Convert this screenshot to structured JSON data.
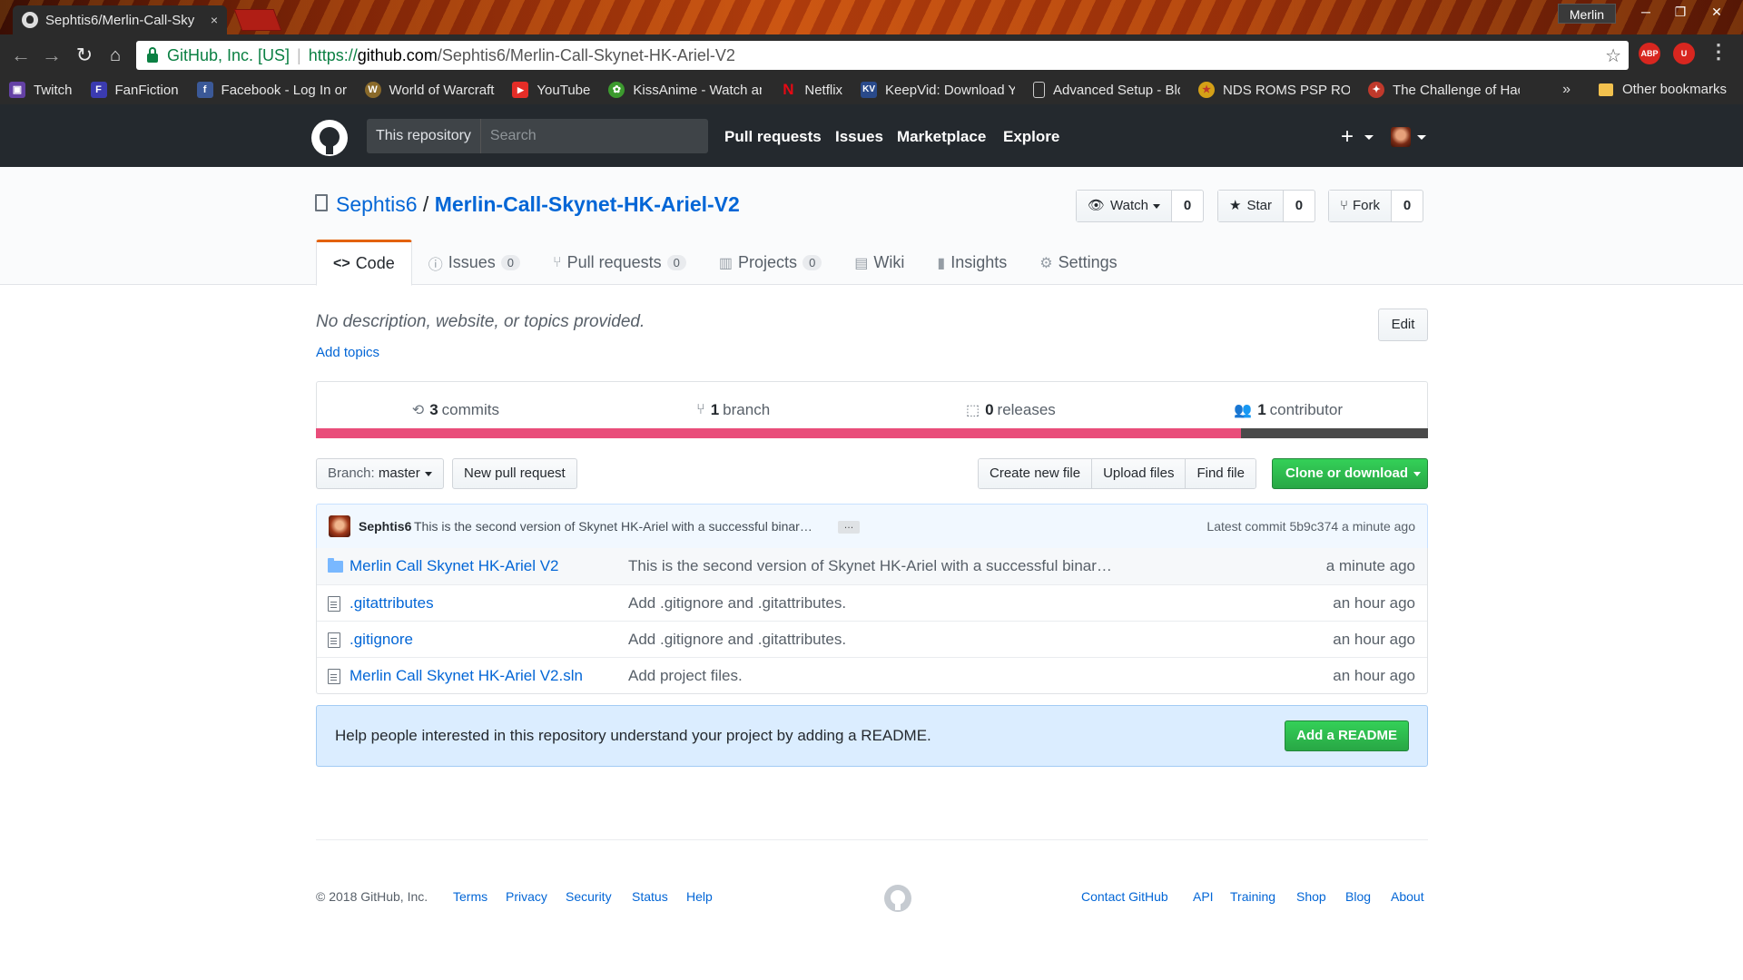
{
  "browser": {
    "tab_title": "Sephtis6/Merlin-Call-Sky",
    "tab_close": "×",
    "user": "Merlin",
    "window_controls": [
      "─",
      "❐",
      "✕"
    ],
    "omnibox": {
      "secure_label": "GitHub, Inc. [US]",
      "url_scheme": "https://",
      "url_host": "github.com",
      "url_path": "/Sephtis6/Merlin-Call-Skynet-HK-Ariel-V2"
    },
    "extensions": [
      "ABP",
      "U"
    ],
    "bookmarks": [
      {
        "label": "Twitch",
        "icon": "twitch-icon",
        "color": "#6441a5",
        "glyph": "▣"
      },
      {
        "label": "FanFiction",
        "icon": "fanfiction-icon",
        "color": "#3b3bb0",
        "glyph": "F"
      },
      {
        "label": "Facebook - Log In or",
        "icon": "facebook-icon",
        "color": "#3b5998",
        "glyph": "f"
      },
      {
        "label": "World of Warcraft",
        "icon": "warcraft-icon",
        "color": "#8a6a2a",
        "glyph": "W"
      },
      {
        "label": "YouTube",
        "icon": "youtube-icon",
        "color": "#e52d27",
        "glyph": "▶"
      },
      {
        "label": "KissAnime - Watch ar",
        "icon": "kissanime-icon",
        "color": "#3c9a2e",
        "glyph": "✿"
      },
      {
        "label": "Netflix",
        "icon": "netflix-icon",
        "color": "#b20710",
        "glyph": "N"
      },
      {
        "label": "KeepVid: Download Y",
        "icon": "keepvid-icon",
        "color": "#2a4a8a",
        "glyph": "KV"
      },
      {
        "label": "Advanced Setup - Blc",
        "icon": "page-icon",
        "color": "#cccccc",
        "glyph": ""
      },
      {
        "label": "NDS ROMS PSP ROM",
        "icon": "nds-icon",
        "color": "#d4a017",
        "glyph": "★"
      },
      {
        "label": "The Challenge of Hac",
        "icon": "challenge-icon",
        "color": "#c0392b",
        "glyph": "✦"
      }
    ],
    "bookmarks_more": "»",
    "other_bookmarks": "Other bookmarks"
  },
  "header": {
    "scope_label": "This repository",
    "search_placeholder": "Search",
    "nav": [
      "Pull requests",
      "Issues",
      "Marketplace",
      "Explore"
    ],
    "plus": "+"
  },
  "repo": {
    "owner": "Sephtis6",
    "separator": "/",
    "name": "Merlin-Call-Skynet-HK-Ariel-V2",
    "watch": {
      "label": "Watch",
      "count": "0"
    },
    "star": {
      "label": "Star",
      "count": "0"
    },
    "fork": {
      "label": "Fork",
      "count": "0"
    },
    "tabs": [
      {
        "label": "Code",
        "icon": "<>",
        "counter": ""
      },
      {
        "label": "Issues",
        "icon": "ⓘ",
        "counter": "0"
      },
      {
        "label": "Pull requests",
        "icon": "⑂",
        "counter": "0"
      },
      {
        "label": "Projects",
        "icon": "▥",
        "counter": "0"
      },
      {
        "label": "Wiki",
        "icon": "▤",
        "counter": ""
      },
      {
        "label": "Insights",
        "icon": "▮",
        "counter": ""
      },
      {
        "label": "Settings",
        "icon": "⚙",
        "counter": ""
      }
    ]
  },
  "main": {
    "description": "No description, website, or topics provided.",
    "add_topics": "Add topics",
    "edit": "Edit",
    "summary": [
      {
        "count": "3",
        "label": "commits",
        "icon": "⟲"
      },
      {
        "count": "1",
        "label": "branch",
        "icon": "⑂"
      },
      {
        "count": "0",
        "label": "releases",
        "icon": "⬚"
      },
      {
        "count": "1",
        "label": "contributor",
        "icon": "👥"
      }
    ],
    "languages": [
      {
        "share": 0.832,
        "color": "#e94d7a"
      },
      {
        "share": 0.168,
        "color": "#4a4a4a"
      }
    ],
    "branch_prefix": "Branch:",
    "branch_name": "master",
    "new_pull_request": "New pull request",
    "file_actions": [
      "Create new file",
      "Upload files",
      "Find file"
    ],
    "clone": "Clone or download",
    "commit": {
      "author": "Sephtis6",
      "message": "This is the second version of Skynet HK-Ariel with a successful binar…",
      "dots": "…",
      "latest_label": "Latest commit",
      "sha": "5b9c374",
      "age": "a minute ago"
    },
    "files": [
      {
        "type": "dir",
        "name": "Merlin Call Skynet HK-Ariel V2",
        "message": "This is the second version of Skynet HK-Ariel with a successful binar…",
        "age": "a minute ago"
      },
      {
        "type": "file",
        "name": ".gitattributes",
        "message": "Add .gitignore and .gitattributes.",
        "age": "an hour ago"
      },
      {
        "type": "file",
        "name": ".gitignore",
        "message": "Add .gitignore and .gitattributes.",
        "age": "an hour ago"
      },
      {
        "type": "file",
        "name": "Merlin Call Skynet HK-Ariel V2.sln",
        "message": "Add project files.",
        "age": "an hour ago"
      }
    ],
    "readme_prompt": "Help people interested in this repository understand your project by adding a README.",
    "readme_button": "Add a README"
  },
  "footer": {
    "copyright": "© 2018 GitHub, Inc.",
    "left_links": [
      "Terms",
      "Privacy",
      "Security",
      "Status",
      "Help"
    ],
    "right_links": [
      "Contact GitHub",
      "API",
      "Training",
      "Shop",
      "Blog",
      "About"
    ]
  }
}
